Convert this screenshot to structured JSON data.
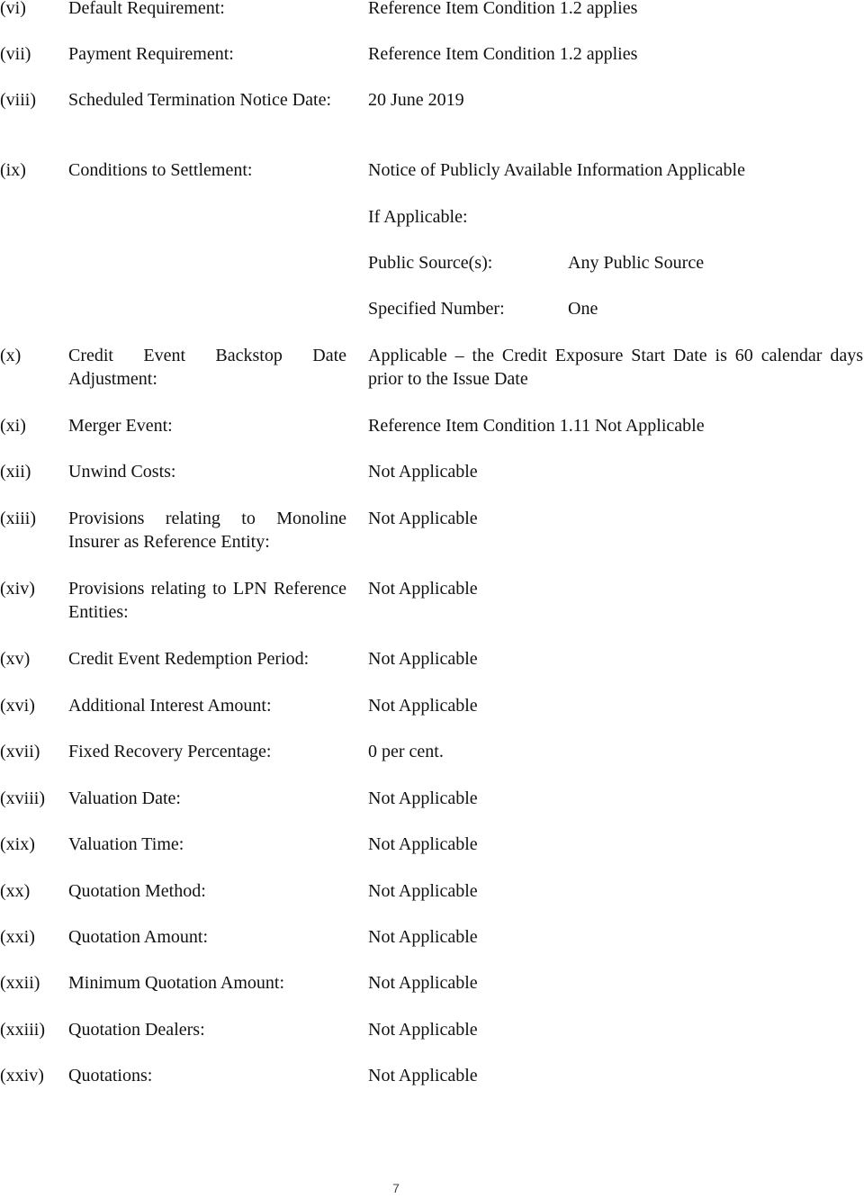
{
  "document": {
    "items": [
      {
        "num": "(vi)",
        "label": "Default Requirement:",
        "value": "Reference Item Condition 1.2 applies"
      },
      {
        "num": "(vii)",
        "label": "Payment Requirement:",
        "value": "Reference Item Condition 1.2 applies"
      },
      {
        "num": "(viii)",
        "label": "Scheduled Termination Notice Date:",
        "value": "20 June 2019"
      },
      {
        "num": "(ix)",
        "label": "Conditions to Settlement:",
        "value": "Notice of Publicly Available Information Applicable"
      },
      {
        "num": "(x)",
        "label": "Credit Event Backstop Date Adjustment:",
        "value": "Applicable – the Credit Exposure Start Date is 60 calendar days prior to the Issue Date"
      },
      {
        "num": "(xi)",
        "label": "Merger Event:",
        "value": "Reference Item Condition 1.11 Not Applicable"
      },
      {
        "num": "(xii)",
        "label": "Unwind Costs:",
        "value": "Not Applicable"
      },
      {
        "num": "(xiii)",
        "label": "Provisions relating to Monoline Insurer as Reference Entity:",
        "value": "Not Applicable"
      },
      {
        "num": "(xiv)",
        "label": "Provisions relating to LPN Reference Entities:",
        "value": "Not Applicable"
      },
      {
        "num": "(xv)",
        "label": "Credit Event Redemption Period:",
        "value": "Not Applicable"
      },
      {
        "num": "(xvi)",
        "label": "Additional Interest Amount:",
        "value": "Not Applicable"
      },
      {
        "num": "(xvii)",
        "label": "Fixed Recovery Percentage:",
        "value": "0 per cent."
      },
      {
        "num": "(xviii)",
        "label": "Valuation Date:",
        "value": "Not Applicable"
      },
      {
        "num": "(xix)",
        "label": "Valuation Time:",
        "value": "Not Applicable"
      },
      {
        "num": "(xx)",
        "label": "Quotation Method:",
        "value": "Not Applicable"
      },
      {
        "num": "(xxi)",
        "label": "Quotation Amount:",
        "value": "Not Applicable"
      },
      {
        "num": "(xxii)",
        "label": "Minimum Quotation Amount:",
        "value": "Not Applicable"
      },
      {
        "num": "(xxiii)",
        "label": "Quotation Dealers:",
        "value": "Not Applicable"
      },
      {
        "num": "(xxiv)",
        "label": "Quotations:",
        "value": "Not Applicable"
      }
    ],
    "settlement_sub": {
      "heading": "If Applicable:",
      "public_source_label": "Public Source(s):",
      "public_source_value": "Any Public Source",
      "specified_number_label": "Specified Number:",
      "specified_number_value": "One"
    },
    "page_number": "7"
  }
}
